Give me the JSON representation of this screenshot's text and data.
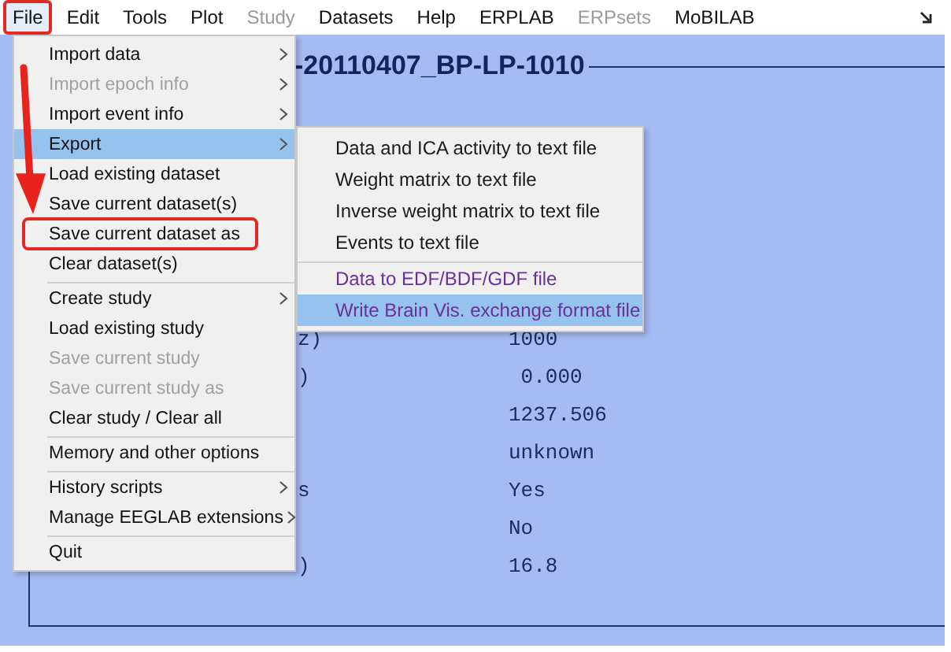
{
  "menu_bar": [
    {
      "label": "File",
      "selected": true,
      "disabled": false,
      "outlined": true
    },
    {
      "label": "Edit",
      "selected": false,
      "disabled": false,
      "outlined": false
    },
    {
      "label": "Tools",
      "selected": false,
      "disabled": false,
      "outlined": false
    },
    {
      "label": "Plot",
      "selected": false,
      "disabled": false,
      "outlined": false
    },
    {
      "label": "Study",
      "selected": false,
      "disabled": true,
      "outlined": false
    },
    {
      "label": "Datasets",
      "selected": false,
      "disabled": false,
      "outlined": false
    },
    {
      "label": "Help",
      "selected": false,
      "disabled": false,
      "outlined": false
    },
    {
      "label": "ERPLAB",
      "selected": false,
      "disabled": false,
      "outlined": false
    },
    {
      "label": "ERPsets",
      "selected": false,
      "disabled": true,
      "outlined": false
    },
    {
      "label": "MoBILAB",
      "selected": false,
      "disabled": false,
      "outlined": false
    }
  ],
  "panel": {
    "title": "-20110407_BP-LP-1010",
    "rows": [
      {
        "label": "z)",
        "value": "1000"
      },
      {
        "label": ")",
        "value": " 0.000"
      },
      {
        "value": "1237.506"
      },
      {
        "value": "unknown"
      },
      {
        "label": "s",
        "value": "Yes"
      },
      {
        "value": "No"
      },
      {
        "label": ")",
        "value": "16.8"
      }
    ]
  },
  "file_menu": [
    {
      "label": "Import data",
      "disabled": false,
      "selected": false,
      "submenu": true,
      "separator_before": false,
      "outlined": false
    },
    {
      "label": "Import epoch info",
      "disabled": true,
      "selected": false,
      "submenu": true,
      "separator_before": false,
      "outlined": false
    },
    {
      "label": "Import event info",
      "disabled": false,
      "selected": false,
      "submenu": true,
      "separator_before": false,
      "outlined": false
    },
    {
      "label": "Export",
      "disabled": false,
      "selected": true,
      "submenu": true,
      "separator_before": false,
      "outlined": false
    },
    {
      "label": "Load existing dataset",
      "disabled": false,
      "selected": false,
      "submenu": false,
      "separator_before": false,
      "outlined": false
    },
    {
      "label": "Save current dataset(s)",
      "disabled": false,
      "selected": false,
      "submenu": false,
      "separator_before": false,
      "outlined": false
    },
    {
      "label": "Save current dataset as",
      "disabled": false,
      "selected": false,
      "submenu": false,
      "separator_before": false,
      "outlined": true
    },
    {
      "label": "Clear dataset(s)",
      "disabled": false,
      "selected": false,
      "submenu": false,
      "separator_before": false,
      "outlined": false
    },
    {
      "label": "Create study",
      "disabled": false,
      "selected": false,
      "submenu": true,
      "separator_before": true,
      "outlined": false
    },
    {
      "label": "Load existing study",
      "disabled": false,
      "selected": false,
      "submenu": false,
      "separator_before": false,
      "outlined": false
    },
    {
      "label": "Save current study",
      "disabled": true,
      "selected": false,
      "submenu": false,
      "separator_before": false,
      "outlined": false
    },
    {
      "label": "Save current study as",
      "disabled": true,
      "selected": false,
      "submenu": false,
      "separator_before": false,
      "outlined": false
    },
    {
      "label": "Clear study / Clear all",
      "disabled": false,
      "selected": false,
      "submenu": false,
      "separator_before": false,
      "outlined": false
    },
    {
      "label": "Memory and other options",
      "disabled": false,
      "selected": false,
      "submenu": false,
      "separator_before": true,
      "outlined": false
    },
    {
      "label": "History scripts",
      "disabled": false,
      "selected": false,
      "submenu": true,
      "separator_before": true,
      "outlined": false
    },
    {
      "label": "Manage EEGLAB extensions",
      "disabled": false,
      "selected": false,
      "submenu": true,
      "separator_before": false,
      "outlined": false
    },
    {
      "label": "Quit",
      "disabled": false,
      "selected": false,
      "submenu": false,
      "separator_before": true,
      "outlined": false
    }
  ],
  "export_submenu": [
    {
      "label": "Data and ICA activity to text file",
      "selected": false,
      "separator_before": false,
      "kind": "text"
    },
    {
      "label": "Weight matrix to text file",
      "selected": false,
      "separator_before": false,
      "kind": "text"
    },
    {
      "label": "Inverse weight matrix to text file",
      "selected": false,
      "separator_before": false,
      "kind": "text"
    },
    {
      "label": "Events to text file",
      "selected": false,
      "separator_before": false,
      "kind": "text"
    },
    {
      "label": "Data to EDF/BDF/GDF file",
      "selected": false,
      "separator_before": true,
      "kind": "format"
    },
    {
      "label": "Write Brain Vis. exchange format file",
      "selected": true,
      "separator_before": false,
      "kind": "format"
    }
  ]
}
